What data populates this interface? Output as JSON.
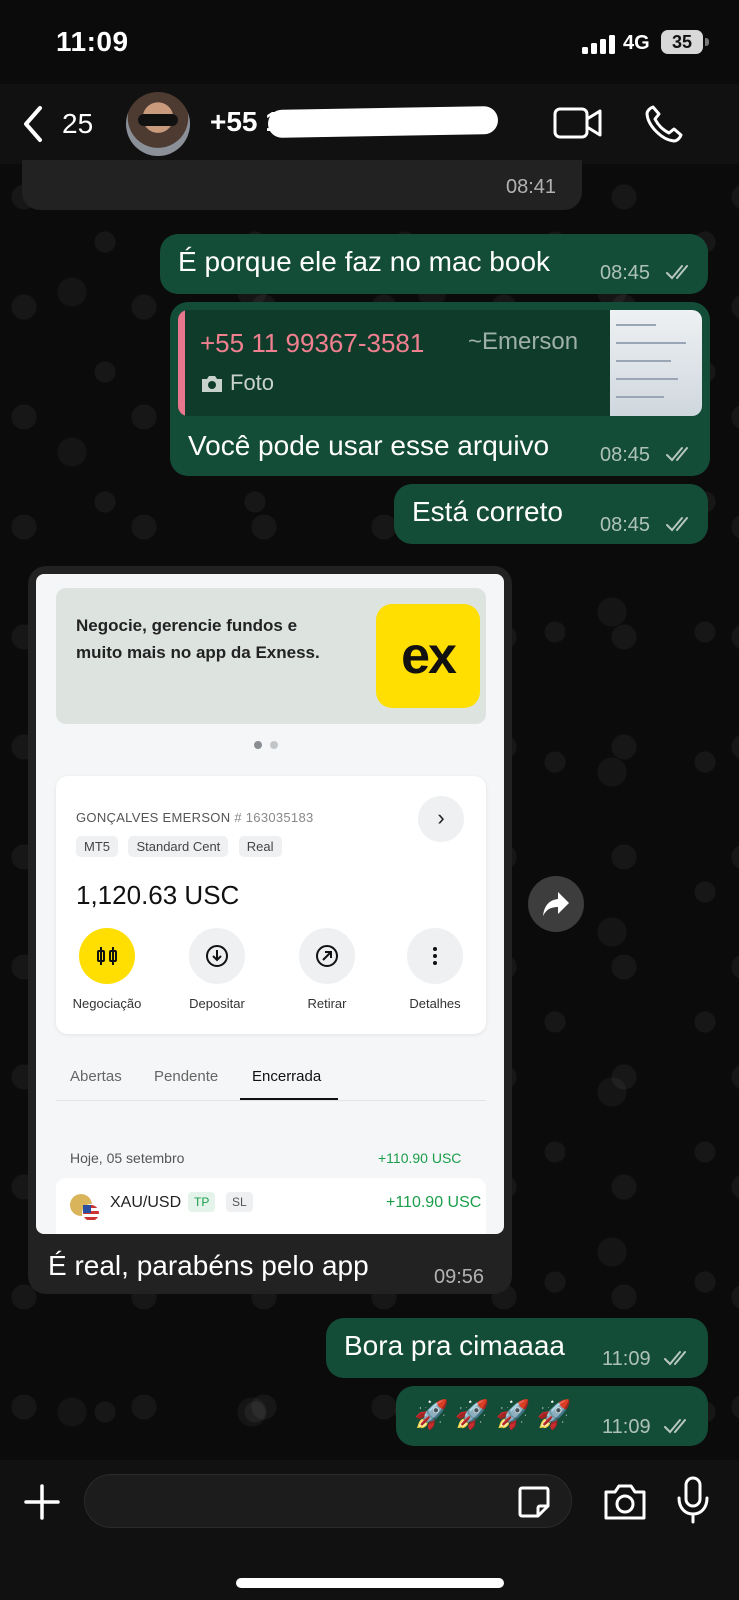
{
  "status_bar": {
    "time": "11:09",
    "network": "4G",
    "battery": "35"
  },
  "header": {
    "back_count": "25",
    "contact_name": "+55 11"
  },
  "messages": [
    {
      "id": "m0",
      "direction": "in",
      "text": "",
      "time": "08:41"
    },
    {
      "id": "m1",
      "direction": "out",
      "text": "É porque ele faz no mac book",
      "time": "08:45",
      "read": true
    },
    {
      "id": "m2",
      "direction": "out",
      "reply_to": {
        "phone": "+55 11 99367-3581",
        "author": "~Emerson",
        "media_label": "Foto"
      },
      "text": "Você pode usar esse arquivo",
      "time": "08:45",
      "read": true
    },
    {
      "id": "m3",
      "direction": "out",
      "text": "Está correto",
      "time": "08:45",
      "read": true
    },
    {
      "id": "m4",
      "direction": "in",
      "text": "É real, parabéns pelo app",
      "time": "09:56"
    },
    {
      "id": "m5",
      "direction": "out",
      "text": "Bora pra cimaaaa",
      "time": "11:09",
      "read": true
    },
    {
      "id": "m6",
      "direction": "out",
      "text": "🚀🚀🚀🚀",
      "time": "11:09",
      "read": true
    }
  ],
  "image_card": {
    "promo_text": "Negocie, gerencie fundos e muito mais no app da Exness.",
    "logo_text": "ex",
    "account": {
      "name": "GONÇALVES EMERSON",
      "number": "# 163035183",
      "tags": [
        "MT5",
        "Standard Cent",
        "Real"
      ],
      "balance": "1,120.63 USC",
      "actions": [
        "Negociação",
        "Depositar",
        "Retirar",
        "Detalhes"
      ]
    },
    "tabs": [
      "Abertas",
      "Pendente",
      "Encerrada"
    ],
    "active_tab": "Encerrada",
    "day_label": "Hoje, 05 setembro",
    "day_total": "+110.90 USC",
    "trade": {
      "symbol": "XAU/USD",
      "tp": "TP",
      "sl": "SL",
      "pl": "+110.90 USC"
    }
  },
  "colors": {
    "outgoing_bubble": "#144d37",
    "incoming_bubble": "#222222",
    "quote_accent": "#e8768c",
    "exness_yellow": "#ffde02",
    "profit_green": "#1a9e4b"
  }
}
